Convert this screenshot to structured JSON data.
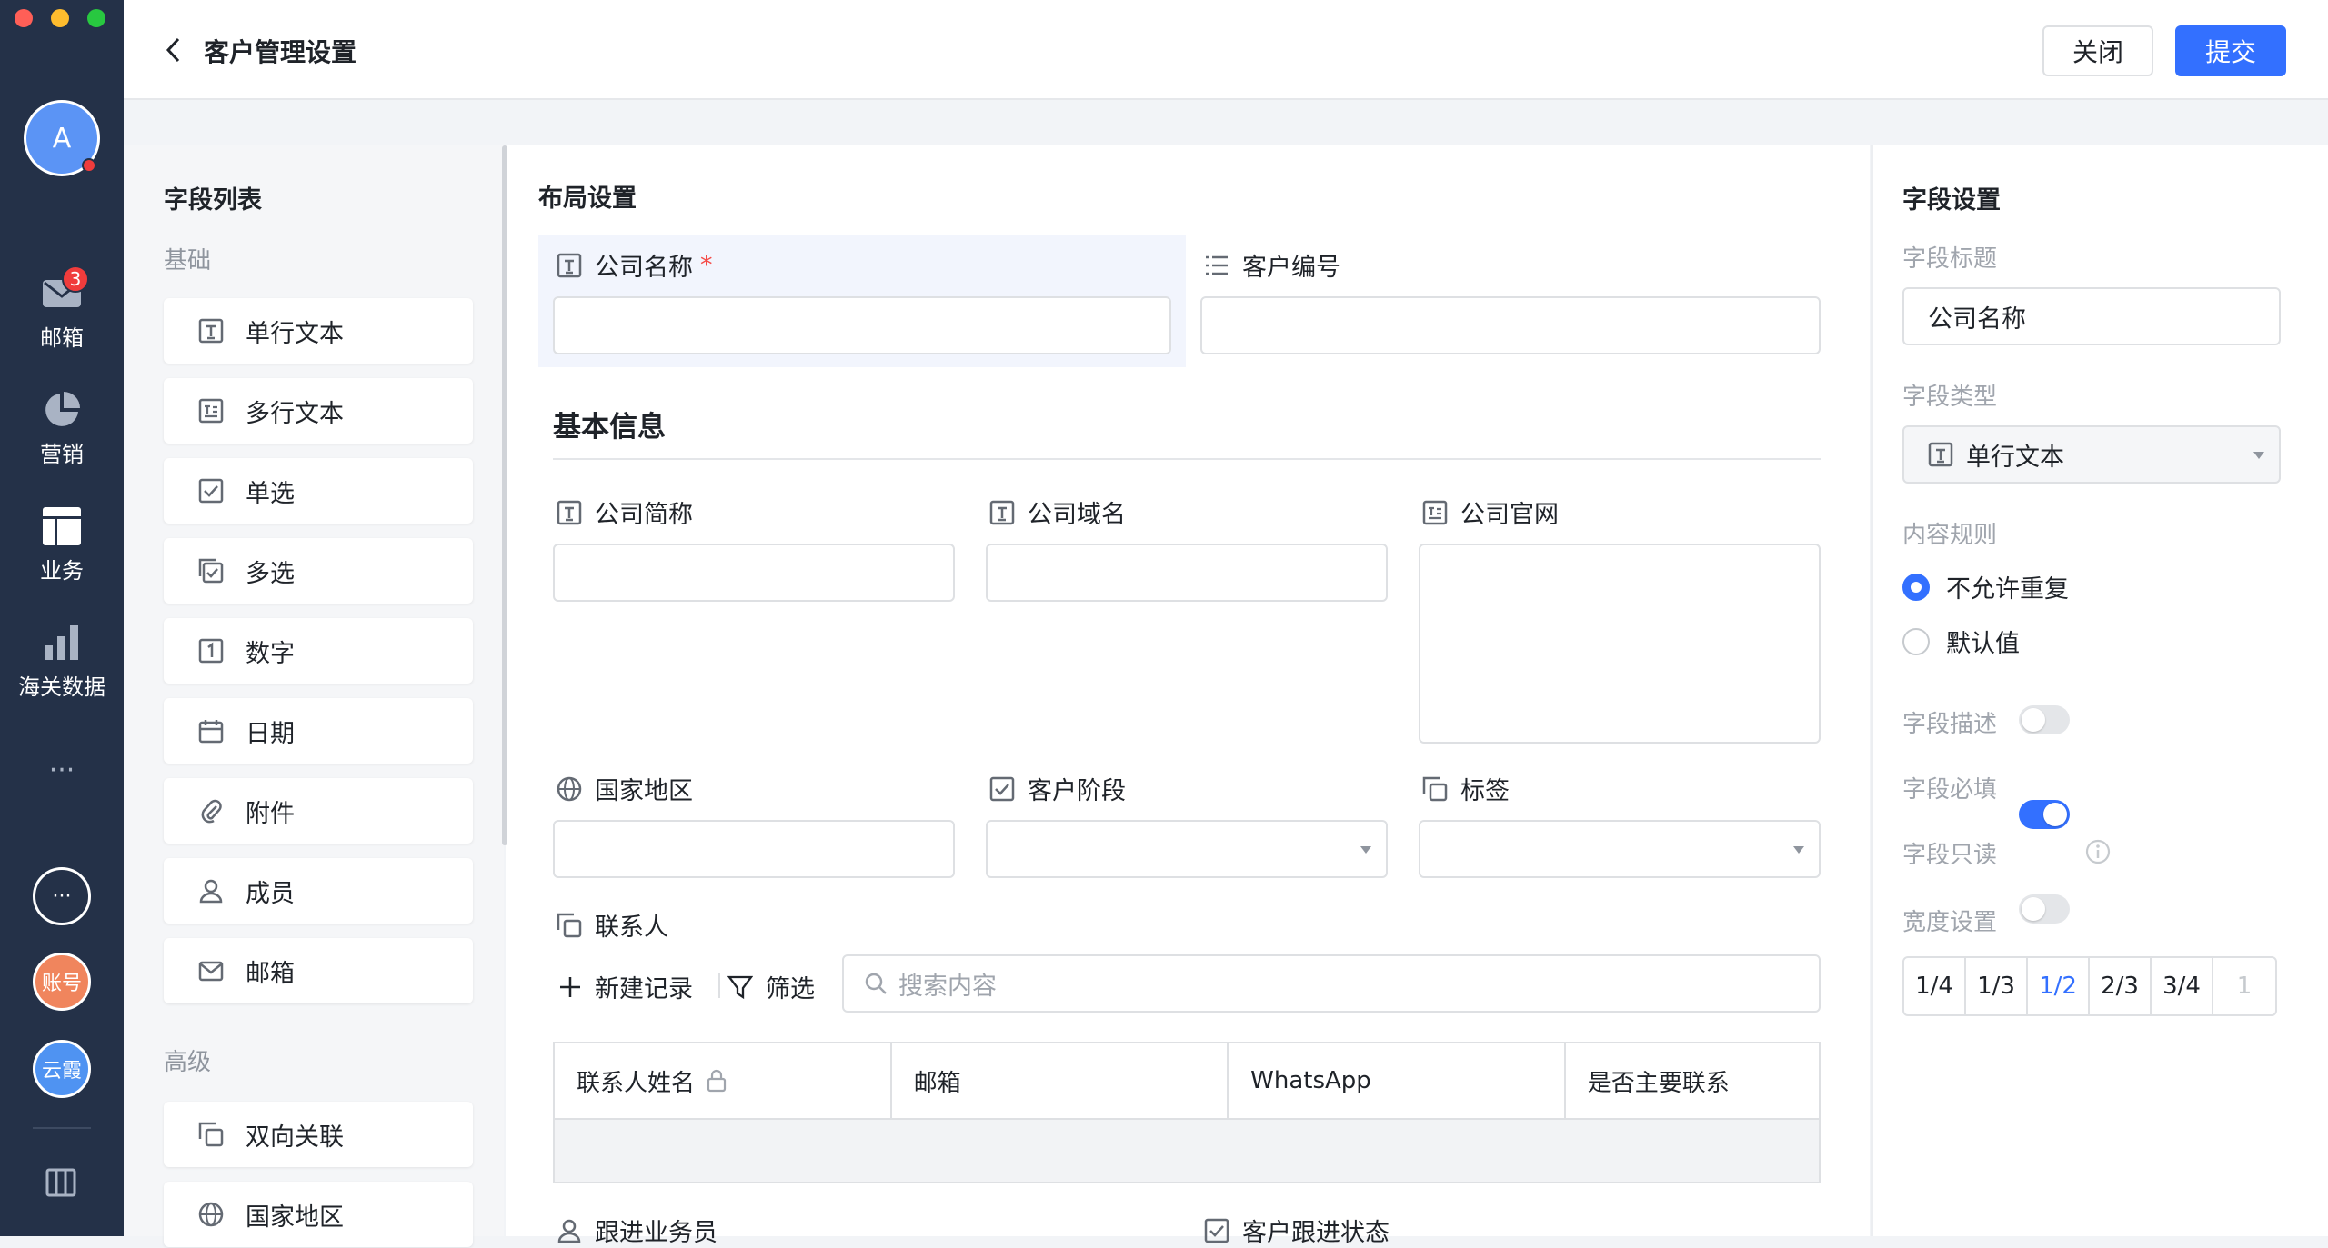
{
  "window_controls": {
    "close": "#ff5f57",
    "minimize": "#febc2e",
    "maximize": "#28c840"
  },
  "rail": {
    "avatar": "A",
    "items": [
      {
        "label": "邮箱",
        "icon": "mail-icon",
        "badge": "3"
      },
      {
        "label": "营销",
        "icon": "pie-chart-icon"
      },
      {
        "label": "业务",
        "icon": "layout-icon"
      },
      {
        "label": "海关数据",
        "icon": "bar-chart-icon"
      }
    ],
    "more": "···",
    "bottom": {
      "more_circle": "···",
      "account": "账号",
      "cloud": "云霞"
    }
  },
  "header": {
    "title": "客户管理设置",
    "close_label": "关闭",
    "submit_label": "提交"
  },
  "field_list": {
    "title": "字段列表",
    "basic_label": "基础",
    "basic": [
      {
        "label": "单行文本",
        "icon": "single-line-text-icon"
      },
      {
        "label": "多行文本",
        "icon": "multi-line-text-icon"
      },
      {
        "label": "单选",
        "icon": "checkbox-icon"
      },
      {
        "label": "多选",
        "icon": "multi-checkbox-icon"
      },
      {
        "label": "数字",
        "icon": "number-icon"
      },
      {
        "label": "日期",
        "icon": "calendar-icon"
      },
      {
        "label": "附件",
        "icon": "paperclip-icon"
      },
      {
        "label": "成员",
        "icon": "user-icon"
      },
      {
        "label": "邮箱",
        "icon": "mail-icon"
      }
    ],
    "advanced_label": "高级",
    "advanced": [
      {
        "label": "双向关联",
        "icon": "link-icon"
      },
      {
        "label": "国家地区",
        "icon": "globe-icon"
      }
    ]
  },
  "layout": {
    "title": "布局设置",
    "company_name": "公司名称",
    "required_mark": "*",
    "customer_no": "客户编号",
    "section": "基本信息",
    "short_name": "公司简称",
    "domain": "公司域名",
    "website": "公司官网",
    "country": "国家地区",
    "stage": "客户阶段",
    "tags": "标签",
    "contacts": "联系人",
    "new_record": "新建记录",
    "filter": "筛选",
    "search_placeholder": "搜索内容",
    "columns": [
      "联系人姓名",
      "邮箱",
      "WhatsApp",
      "是否主要联系"
    ],
    "follow_person": "跟进业务员",
    "follow_status": "客户跟进状态"
  },
  "field_settings": {
    "title": "字段设置",
    "field_title_label": "字段标题",
    "field_title_value": "公司名称",
    "field_type_label": "字段类型",
    "field_type_value": "单行文本",
    "rule_label": "内容规则",
    "rules": [
      {
        "label": "不允许重复",
        "selected": true
      },
      {
        "label": "默认值",
        "selected": false
      }
    ],
    "desc_label": "字段描述",
    "desc_on": false,
    "required_label": "字段必填",
    "required_on": true,
    "readonly_label": "字段只读",
    "readonly_on": false,
    "width_label": "宽度设置",
    "widths": [
      "1/4",
      "1/3",
      "1/2",
      "2/3",
      "3/4",
      "1"
    ],
    "width_selected": "1/2"
  },
  "accent": "#3370ff"
}
